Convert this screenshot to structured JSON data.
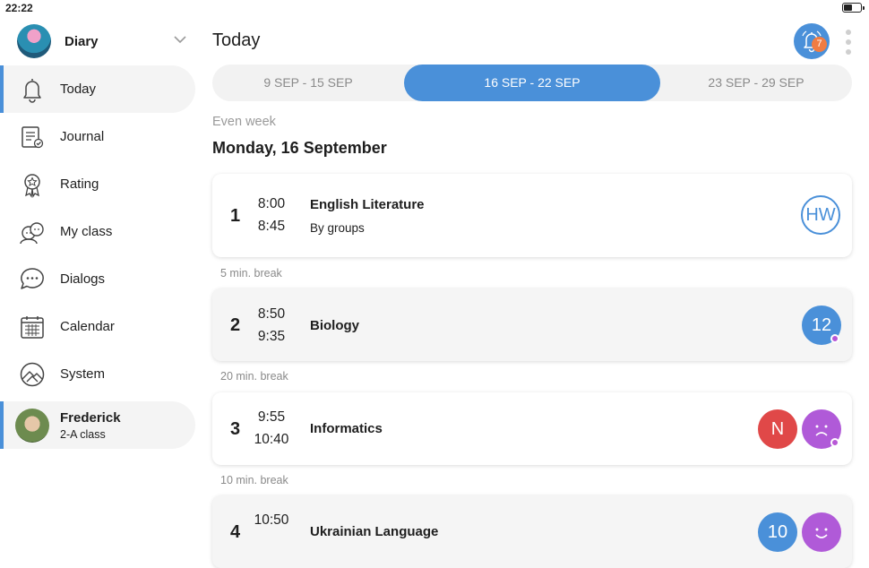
{
  "status_bar": {
    "time": "22:22"
  },
  "sidebar": {
    "header": {
      "title": "Diary"
    },
    "items": [
      {
        "label": "Today",
        "icon": "bell-icon",
        "active": true
      },
      {
        "label": "Journal",
        "icon": "journal-icon"
      },
      {
        "label": "Rating",
        "icon": "award-ribbon-icon"
      },
      {
        "label": "My class",
        "icon": "classmates-icon"
      },
      {
        "label": "Dialogs",
        "icon": "chat-bubble-icon"
      },
      {
        "label": "Calendar",
        "icon": "calendar-icon"
      },
      {
        "label": "System",
        "icon": "system-icon"
      }
    ],
    "user": {
      "name": "Frederick",
      "class": "2-A class"
    }
  },
  "main": {
    "title": "Today",
    "notifications": {
      "count": "7"
    },
    "weeks": [
      {
        "label": "9 SEP - 15 SEP",
        "active": false
      },
      {
        "label": "16 SEP - 22 SEP",
        "active": true
      },
      {
        "label": "23 SEP - 29 SEP",
        "active": false
      }
    ],
    "week_parity": "Even week",
    "day": "Monday, 16 September",
    "lessons": [
      {
        "number": "1",
        "start": "8:00",
        "end": "8:45",
        "subject": "English Literature",
        "note": "By groups",
        "badges": [
          {
            "text": "HW",
            "type": "homework"
          }
        ]
      },
      {
        "number": "2",
        "start": "8:50",
        "end": "9:35",
        "subject": "Biology",
        "badges": [
          {
            "text": "12",
            "type": "grade"
          }
        ]
      },
      {
        "number": "3",
        "start": "9:55",
        "end": "10:40",
        "subject": "Informatics",
        "badges": [
          {
            "text": "N",
            "type": "absence"
          },
          {
            "text": "",
            "type": "sad-mood-icon"
          }
        ]
      },
      {
        "number": "4",
        "start": "10:50",
        "end": "",
        "subject": "Ukrainian Language",
        "badges": [
          {
            "text": "10",
            "type": "grade"
          },
          {
            "text": "",
            "type": "happy-mood-icon"
          }
        ]
      }
    ],
    "breaks": [
      "5 min. break",
      "20 min. break",
      "10 min. break"
    ]
  },
  "colors": {
    "accent": "#4a90d9",
    "absence": "#e04848",
    "mood": "#b05ad8",
    "badge": "#f07c43"
  }
}
